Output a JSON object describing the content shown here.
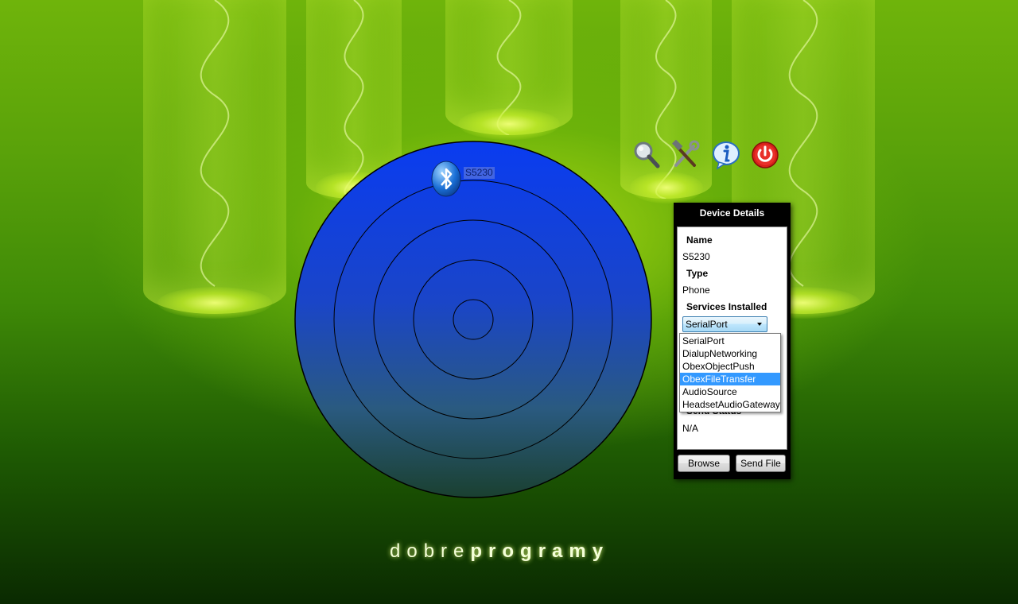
{
  "app": {
    "brand_light": "dobre",
    "brand_bold": "programy"
  },
  "radar": {
    "device_label": "S5230",
    "device_icon": "bluetooth-icon"
  },
  "toolbar": {
    "search_icon": "magnifier-icon",
    "settings_icon": "tools-icon",
    "info_icon": "info-icon",
    "power_icon": "power-icon"
  },
  "details": {
    "title": "Device Details",
    "name_label": "Name",
    "name_value": "S5230",
    "type_label": "Type",
    "type_value": "Phone",
    "services_label": "Services Installed",
    "services_selected": "SerialPort",
    "services_options": [
      "SerialPort",
      "DialupNetworking",
      "ObexObjectPush",
      "ObexFileTransfer",
      "AudioSource",
      "HeadsetAudioGateway"
    ],
    "highlighted_option": "ObexFileTransfer",
    "send_status_label": "Send Status",
    "send_status_value": "N/A",
    "browse_button": "Browse",
    "send_button": "Send File"
  },
  "colors": {
    "radar_blue": "#0a3cf0",
    "highlight": "#3399ff",
    "background_green": "#5aa20a"
  }
}
